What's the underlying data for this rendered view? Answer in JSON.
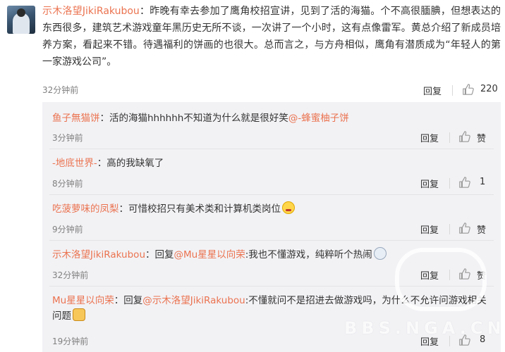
{
  "main_comment": {
    "username": "示木洛望JikiRakubou",
    "text": "：昨晚有幸去参加了鹰角校招宣讲，见到了活的海猫。个不高很腼腆，但想表达的东西很多，建筑艺术游戏童年黑历史无所不谈，一次讲了一个小时，这有点像雷军。黄总介绍了新成员培养方案，看起来不错。待遇福利的饼画的也很大。总而言之，与方舟相似，鹰角有潜质成为“年轻人的第一家游戏公司”。",
    "time": "32分钟前",
    "reply_label": "回复",
    "like_count": "220"
  },
  "replies": [
    {
      "username": "鱼子無猫饼",
      "text": "：活的海猫hhhhhh不知道为什么就是很好笑",
      "mention": "@-蜂蜜柚子饼",
      "time": "3分钟前",
      "reply_label": "回复",
      "like_label": "赞"
    },
    {
      "username": "-地底世界-",
      "text": "：高的我缺氧了",
      "time": "8分钟前",
      "reply_label": "回复",
      "like_label": "1"
    },
    {
      "username": "吃菠萝味的凤梨",
      "text": "：可惜校招只有美术类和计算机类岗位",
      "time": "9分钟前",
      "reply_label": "回复",
      "like_label": "赞"
    },
    {
      "username": "示木洛望JikiRakubou",
      "prefix": "：回复",
      "mention": "@Mu星星以向荣",
      "text": ":我也不懂游戏，纯粹听个热闹",
      "time": "32分钟前",
      "reply_label": "回复",
      "like_label": "赞"
    },
    {
      "username": "Mu星星以向荣",
      "prefix": "：回复",
      "mention": "@示木洛望JikiRakubou",
      "text": ":不懂就问不是招进去做游戏吗，为什么不允许问游戏相关问题",
      "time": "19分钟前",
      "reply_label": "回复",
      "like_label": "8"
    }
  ],
  "watermark": "BBS.NGA.CN",
  "colors": {
    "username": "#eb7350",
    "reply_bg": "#f2f2f5",
    "time": "#808080"
  }
}
